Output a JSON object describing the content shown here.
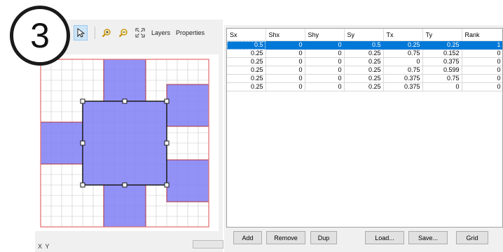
{
  "step_badge": "3",
  "toolbar": {
    "tools": [
      {
        "icon": "pointer-icon",
        "glyph": "⬉",
        "active": true
      },
      {
        "icon": "zoom-in-icon",
        "glyph": "🔍",
        "active": false
      },
      {
        "icon": "zoom-out-icon",
        "glyph": "🔎",
        "active": false
      },
      {
        "icon": "fit-extent-icon",
        "glyph": "⛶",
        "active": false
      }
    ],
    "layers_label": "Layers",
    "properties_label": "Properties"
  },
  "canvas": {
    "grid_color": "#c8c8c8",
    "fill_color": "#7f7ff5",
    "outline_color": "#e26a6a",
    "selection_color": "#1a1a1a"
  },
  "status": {
    "coord_label": "X Y",
    "progress": 0.0
  },
  "table": {
    "columns": [
      "Sx",
      "Shx",
      "Shy",
      "Sy",
      "Tx",
      "Ty",
      "Rank"
    ],
    "rows": [
      [
        "0.5",
        "0",
        "0",
        "0.5",
        "0.25",
        "0.25",
        "1"
      ],
      [
        "0.25",
        "0",
        "0",
        "0.25",
        "0.75",
        "0.152",
        "0"
      ],
      [
        "0.25",
        "0",
        "0",
        "0.25",
        "0",
        "0.375",
        "0"
      ],
      [
        "0.25",
        "0",
        "0",
        "0.25",
        "0.75",
        "0.599",
        "0"
      ],
      [
        "0.25",
        "0",
        "0",
        "0.25",
        "0.375",
        "0.75",
        "0"
      ],
      [
        "0.25",
        "0",
        "0",
        "0.25",
        "0.375",
        "0",
        "0"
      ]
    ],
    "selected_row": 0
  },
  "buttons": {
    "add": "Add",
    "remove": "Remove",
    "dup": "Dup",
    "load": "Load...",
    "save": "Save...",
    "grid": "Grid"
  }
}
